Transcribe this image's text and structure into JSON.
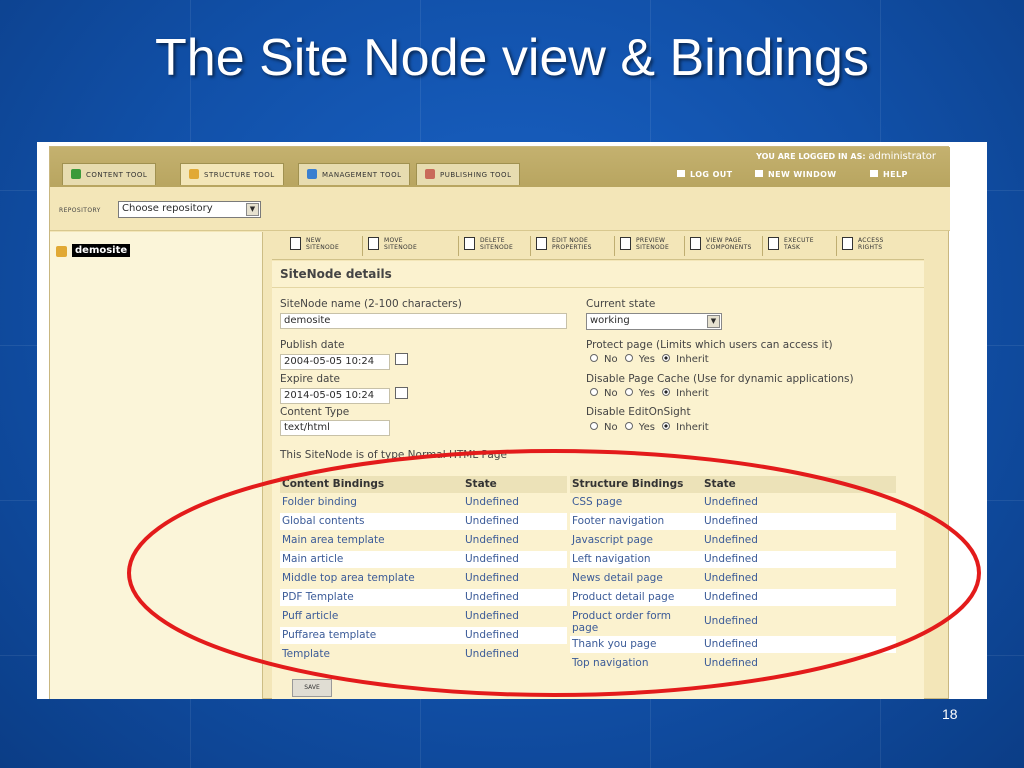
{
  "slide": {
    "title": "The Site Node view & Bindings",
    "page_number": "18"
  },
  "app": {
    "tabs": [
      {
        "label": "CONTENT TOOL",
        "icon": "content-tool-icon",
        "color": "#3a9a3a"
      },
      {
        "label": "STRUCTURE TOOL",
        "icon": "structure-tool-icon",
        "color": "#e1a935",
        "active": true
      },
      {
        "label": "MANAGEMENT TOOL",
        "icon": "management-tool-icon",
        "color": "#3a7fd0"
      },
      {
        "label": "PUBLISHING TOOL",
        "icon": "publishing-tool-icon",
        "color": "#c96a5a"
      }
    ],
    "logged_in_label": "YOU ARE LOGGED IN AS:",
    "logged_in_user": "administrator",
    "links": {
      "logout": "LOG OUT",
      "new_window": "NEW WINDOW",
      "help": "HELP"
    },
    "repository": {
      "label": "REPOSITORY",
      "selected": "Choose repository"
    },
    "tree": {
      "root": "demosite"
    },
    "toolbar": [
      {
        "label": "NEW\nSITENODE",
        "icon": "new-sitenode-icon"
      },
      {
        "label": "MOVE\nSITENODE",
        "icon": "move-sitenode-icon"
      },
      {
        "label": "DELETE\nSITENODE",
        "icon": "delete-sitenode-icon"
      },
      {
        "label": "EDIT NODE\nPROPERTIES",
        "icon": "edit-properties-icon"
      },
      {
        "label": "PREVIEW\nSITENODE",
        "icon": "preview-sitenode-icon"
      },
      {
        "label": "VIEW PAGE\nCOMPONENTS",
        "icon": "view-components-icon"
      },
      {
        "label": "EXECUTE\nTASK",
        "icon": "execute-task-icon"
      },
      {
        "label": "ACCESS\nRIGHTS",
        "icon": "access-rights-icon"
      }
    ],
    "details": {
      "title": "SiteNode details",
      "name_label": "SiteNode name (2-100 characters)",
      "name_value": "demosite",
      "publish_label": "Publish date",
      "publish_value": "2004-05-05 10:24",
      "expire_label": "Expire date",
      "expire_value": "2014-05-05 10:24",
      "content_type_label": "Content Type",
      "content_type_value": "text/html",
      "type_note": "This SiteNode is of type Normal HTML Page",
      "state_label": "Current state",
      "state_value": "working",
      "protect_label": "Protect page (Limits which users can access it)",
      "cache_label": "Disable Page Cache (Use for dynamic applications)",
      "editonsight_label": "Disable EditOnSight",
      "radio_no": "No",
      "radio_yes": "Yes",
      "radio_inherit": "Inherit"
    },
    "bindings": {
      "content_header": "Content Bindings",
      "structure_header": "Structure Bindings",
      "state_header": "State",
      "content": [
        {
          "name": "Folder binding",
          "state": "Undefined"
        },
        {
          "name": "Global contents",
          "state": "Undefined"
        },
        {
          "name": "Main area template",
          "state": "Undefined"
        },
        {
          "name": "Main article",
          "state": "Undefined"
        },
        {
          "name": "Middle top area template",
          "state": "Undefined"
        },
        {
          "name": "PDF Template",
          "state": "Undefined"
        },
        {
          "name": "Puff article",
          "state": "Undefined"
        },
        {
          "name": "Puffarea template",
          "state": "Undefined"
        },
        {
          "name": "Template",
          "state": "Undefined"
        }
      ],
      "structure": [
        {
          "name": "CSS page",
          "state": "Undefined"
        },
        {
          "name": "Footer navigation",
          "state": "Undefined"
        },
        {
          "name": "Javascript page",
          "state": "Undefined"
        },
        {
          "name": "Left navigation",
          "state": "Undefined"
        },
        {
          "name": "News detail page",
          "state": "Undefined"
        },
        {
          "name": "Product detail page",
          "state": "Undefined"
        },
        {
          "name": "Product order form\npage",
          "state": "Undefined"
        },
        {
          "name": "Thank you page",
          "state": "Undefined"
        },
        {
          "name": "Top navigation",
          "state": "Undefined"
        }
      ]
    },
    "save_label": "SAVE"
  },
  "colors": {
    "slide_bg": "#1150a8",
    "app_bg": "#f3e6b8",
    "link_blue": "#3b5b98",
    "highlight_red": "#e31b1b"
  }
}
